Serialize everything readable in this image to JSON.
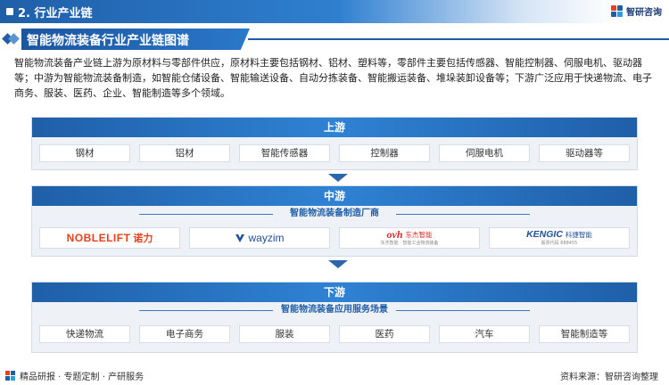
{
  "header": {
    "section_title": "2. 行业产业链",
    "brand": "智研咨询"
  },
  "title": "智能物流装备行业产业链图谱",
  "intro": "智能物流装备产业链上游为原材料与零部件供应，原材料主要包括钢材、铝材、塑料等，零部件主要包括传感器、智能控制器、伺服电机、驱动器等；中游为智能物流装备制造，如智能仓储设备、智能输送设备、自动分拣装备、智能搬运装备、堆垛装卸设备等；下游广泛应用于快递物流、电子商务、服装、医药、企业、智能制造等多个领域。",
  "upstream": {
    "label": "上游",
    "items": [
      "钢材",
      "铝材",
      "智能传感器",
      "控制器",
      "伺服电机",
      "驱动器等"
    ]
  },
  "midstream": {
    "label": "中游",
    "subtitle": "智能物流装备制造厂商",
    "companies": [
      {
        "name": "NOBLELIFT",
        "cn": "诺力",
        "color": "#e8401c"
      },
      {
        "name": "wayzim",
        "color": "#1f4f9a"
      },
      {
        "name": "ovh",
        "cn": "东杰智能",
        "tagline": "东杰智能 · 智能工业物流装备",
        "color": "#d42a2a"
      },
      {
        "name": "KENGIC",
        "cn": "科捷智能",
        "tagline": "股票代码 688455",
        "color": "#1f4f9a"
      }
    ]
  },
  "downstream": {
    "label": "下游",
    "subtitle": "智能物流装备应用服务场景",
    "items": [
      "快递物流",
      "电子商务",
      "服装",
      "医药",
      "汽车",
      "智能制造等"
    ]
  },
  "footer": {
    "left": "精品研报 · 专题定制 · 产研服务",
    "source": "资料来源：智研咨询整理"
  }
}
